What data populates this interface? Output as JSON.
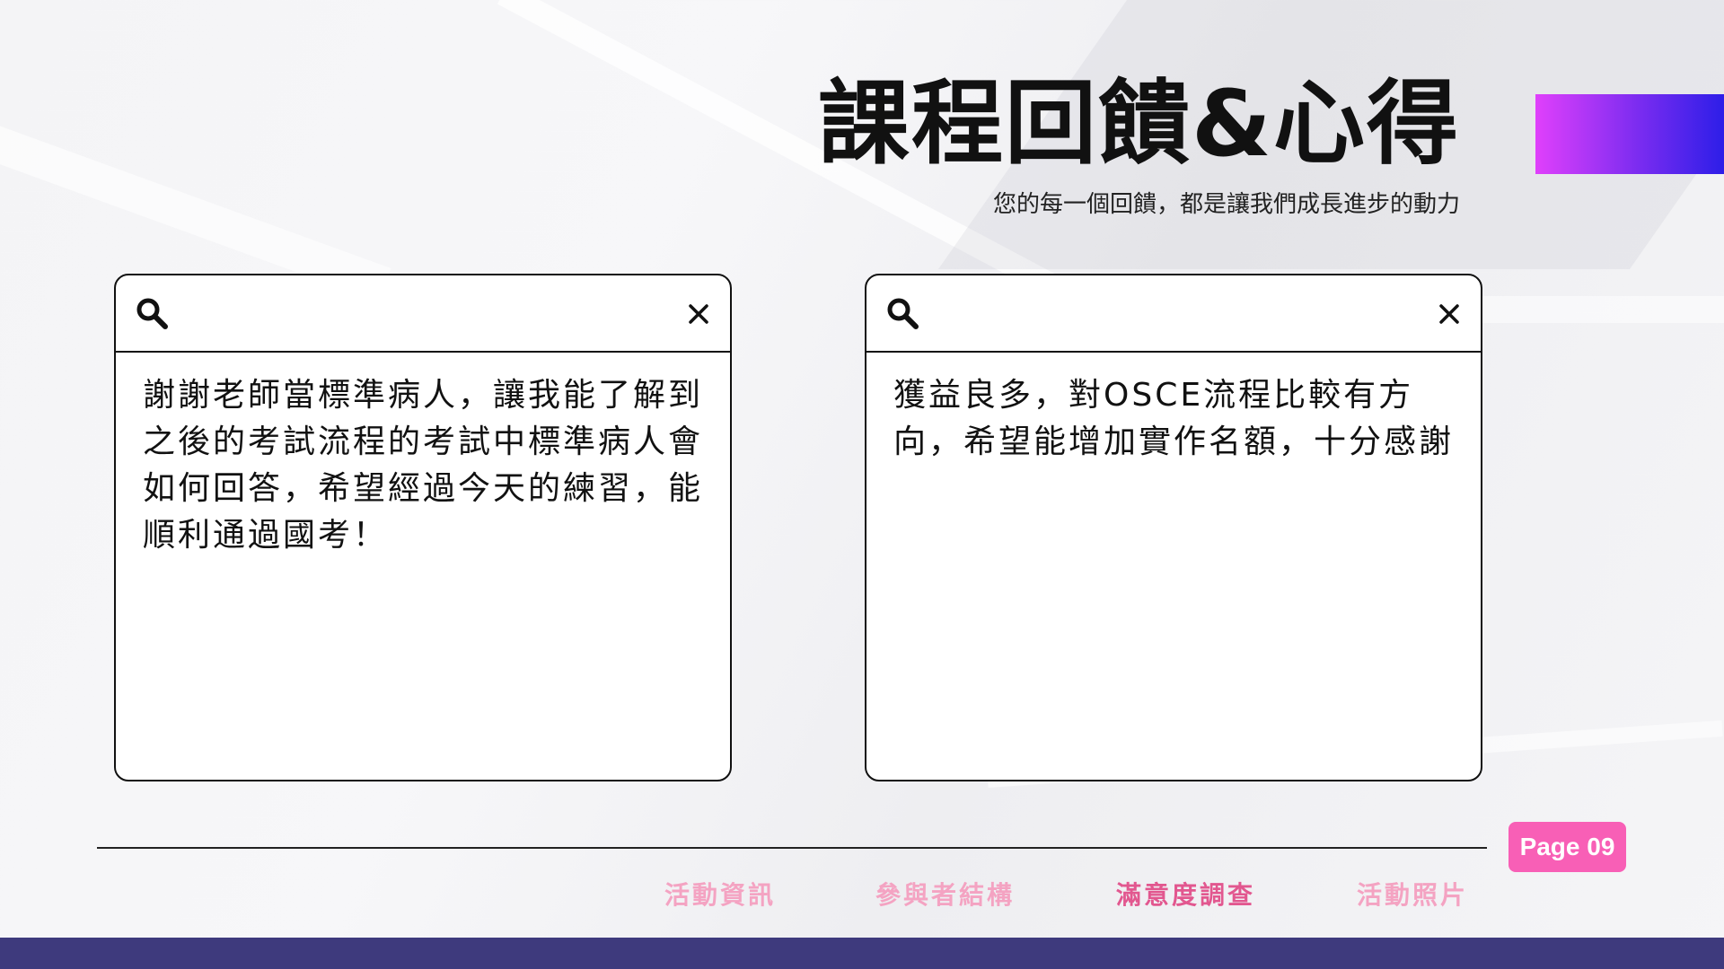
{
  "header": {
    "title": "課程回饋&心得",
    "subtitle": "您的每一個回饋，都是讓我們成長進步的動力"
  },
  "cards": [
    {
      "text": "謝謝老師當標準病人，讓我能了解到之後的考試流程的考試中標準病人會如何回答，希望經過今天的練習，能順利通過國考！",
      "search_icon": "search-icon",
      "close_icon": "close-icon"
    },
    {
      "text": "獲益良多，對OSCE流程比較有方向，希望能增加實作名額，十分感謝",
      "search_icon": "search-icon",
      "close_icon": "close-icon"
    }
  ],
  "page_badge": "Page 09",
  "nav": {
    "items": [
      {
        "label": "活動資訊",
        "active": false
      },
      {
        "label": "參與者結構",
        "active": false
      },
      {
        "label": "滿意度調查",
        "active": true
      },
      {
        "label": "活動照片",
        "active": false
      }
    ]
  },
  "colors": {
    "accent_gradient": [
      "#e040fb",
      "#2d1ee8"
    ],
    "badge": "#f85fb6",
    "nav_inactive": "#f4a3c2",
    "nav_active": "#e2578f",
    "footer": "#3e3a7d"
  }
}
